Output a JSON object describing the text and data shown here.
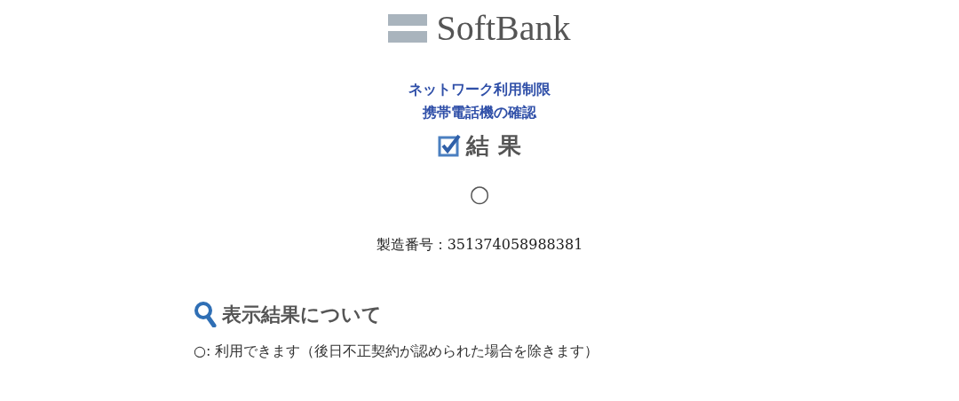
{
  "logo": {
    "text": "SoftBank"
  },
  "title_lines": [
    "ネットワーク利用制限",
    "携帯電話機の確認"
  ],
  "result_heading": "結 果",
  "result_mark": "○",
  "serial": "製造番号：351374058988381",
  "legend_heading": "表示結果について",
  "legend": [
    "○: 利用できます（後日不正契約が認められた場合を除きます）"
  ]
}
